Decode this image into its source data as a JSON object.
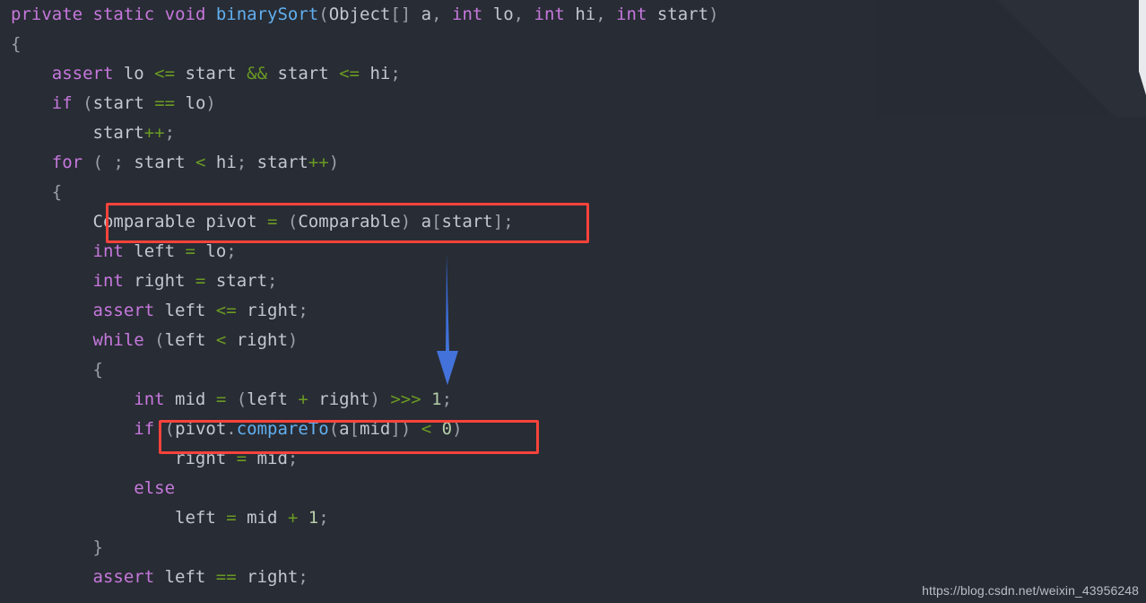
{
  "editor": {
    "background_color": "#282c34",
    "language": "java",
    "code_lines": [
      {
        "indent": 0,
        "tokens": [
          {
            "t": "private",
            "c": "kw"
          },
          {
            "t": " ",
            "c": "id"
          },
          {
            "t": "static",
            "c": "kw"
          },
          {
            "t": " ",
            "c": "id"
          },
          {
            "t": "void",
            "c": "kw"
          },
          {
            "t": " ",
            "c": "id"
          },
          {
            "t": "binarySort",
            "c": "fn"
          },
          {
            "t": "(",
            "c": "pn"
          },
          {
            "t": "Object",
            "c": "id"
          },
          {
            "t": "[] ",
            "c": "pn"
          },
          {
            "t": "a",
            "c": "id"
          },
          {
            "t": ", ",
            "c": "pn"
          },
          {
            "t": "int",
            "c": "kw"
          },
          {
            "t": " lo",
            "c": "id"
          },
          {
            "t": ", ",
            "c": "pn"
          },
          {
            "t": "int",
            "c": "kw"
          },
          {
            "t": " hi",
            "c": "id"
          },
          {
            "t": ", ",
            "c": "pn"
          },
          {
            "t": "int",
            "c": "kw"
          },
          {
            "t": " start",
            "c": "id"
          },
          {
            "t": ")",
            "c": "pn"
          }
        ]
      },
      {
        "indent": 0,
        "tokens": [
          {
            "t": "{",
            "c": "pn"
          }
        ]
      },
      {
        "indent": 4,
        "tokens": [
          {
            "t": "assert",
            "c": "kw"
          },
          {
            "t": " lo ",
            "c": "id"
          },
          {
            "t": "<=",
            "c": "op"
          },
          {
            "t": " start ",
            "c": "id"
          },
          {
            "t": "&&",
            "c": "op"
          },
          {
            "t": " start ",
            "c": "id"
          },
          {
            "t": "<=",
            "c": "op"
          },
          {
            "t": " hi",
            "c": "id"
          },
          {
            "t": ";",
            "c": "pn"
          }
        ]
      },
      {
        "indent": 4,
        "tokens": [
          {
            "t": "if",
            "c": "kw"
          },
          {
            "t": " ",
            "c": "id"
          },
          {
            "t": "(",
            "c": "pn"
          },
          {
            "t": "start ",
            "c": "id"
          },
          {
            "t": "==",
            "c": "op"
          },
          {
            "t": " lo",
            "c": "id"
          },
          {
            "t": ")",
            "c": "pn"
          }
        ]
      },
      {
        "indent": 8,
        "tokens": [
          {
            "t": "start",
            "c": "id"
          },
          {
            "t": "++",
            "c": "op"
          },
          {
            "t": ";",
            "c": "pn"
          }
        ]
      },
      {
        "indent": 4,
        "tokens": [
          {
            "t": "for",
            "c": "kw"
          },
          {
            "t": " ",
            "c": "id"
          },
          {
            "t": "(",
            "c": "pn"
          },
          {
            "t": " ",
            "c": "id"
          },
          {
            "t": ";",
            "c": "pn"
          },
          {
            "t": " start ",
            "c": "id"
          },
          {
            "t": "<",
            "c": "op"
          },
          {
            "t": " hi",
            "c": "id"
          },
          {
            "t": ";",
            "c": "pn"
          },
          {
            "t": " start",
            "c": "id"
          },
          {
            "t": "++",
            "c": "op"
          },
          {
            "t": ")",
            "c": "pn"
          }
        ]
      },
      {
        "indent": 4,
        "tokens": [
          {
            "t": "{",
            "c": "pn"
          }
        ]
      },
      {
        "indent": 8,
        "tokens": [
          {
            "t": "Comparable",
            "c": "id"
          },
          {
            "t": " pivot ",
            "c": "id"
          },
          {
            "t": "=",
            "c": "op"
          },
          {
            "t": " ",
            "c": "id"
          },
          {
            "t": "(",
            "c": "pn"
          },
          {
            "t": "Comparable",
            "c": "id"
          },
          {
            "t": ") ",
            "c": "pn"
          },
          {
            "t": "a",
            "c": "id"
          },
          {
            "t": "[",
            "c": "pn"
          },
          {
            "t": "start",
            "c": "id"
          },
          {
            "t": "]",
            "c": "pn"
          },
          {
            "t": ";",
            "c": "pn"
          }
        ]
      },
      {
        "indent": 8,
        "tokens": [
          {
            "t": "int",
            "c": "kw"
          },
          {
            "t": " left ",
            "c": "id"
          },
          {
            "t": "=",
            "c": "op"
          },
          {
            "t": " lo",
            "c": "id"
          },
          {
            "t": ";",
            "c": "pn"
          }
        ]
      },
      {
        "indent": 8,
        "tokens": [
          {
            "t": "int",
            "c": "kw"
          },
          {
            "t": " right ",
            "c": "id"
          },
          {
            "t": "=",
            "c": "op"
          },
          {
            "t": " start",
            "c": "id"
          },
          {
            "t": ";",
            "c": "pn"
          }
        ]
      },
      {
        "indent": 8,
        "tokens": [
          {
            "t": "assert",
            "c": "kw"
          },
          {
            "t": " left ",
            "c": "id"
          },
          {
            "t": "<=",
            "c": "op"
          },
          {
            "t": " right",
            "c": "id"
          },
          {
            "t": ";",
            "c": "pn"
          }
        ]
      },
      {
        "indent": 8,
        "tokens": [
          {
            "t": "while",
            "c": "kw"
          },
          {
            "t": " ",
            "c": "id"
          },
          {
            "t": "(",
            "c": "pn"
          },
          {
            "t": "left ",
            "c": "id"
          },
          {
            "t": "<",
            "c": "op"
          },
          {
            "t": " right",
            "c": "id"
          },
          {
            "t": ")",
            "c": "pn"
          }
        ]
      },
      {
        "indent": 8,
        "tokens": [
          {
            "t": "{",
            "c": "pn"
          }
        ]
      },
      {
        "indent": 12,
        "tokens": [
          {
            "t": "int",
            "c": "kw"
          },
          {
            "t": " mid ",
            "c": "id"
          },
          {
            "t": "=",
            "c": "op"
          },
          {
            "t": " ",
            "c": "id"
          },
          {
            "t": "(",
            "c": "pn"
          },
          {
            "t": "left ",
            "c": "id"
          },
          {
            "t": "+",
            "c": "op"
          },
          {
            "t": " right",
            "c": "id"
          },
          {
            "t": ") ",
            "c": "pn"
          },
          {
            "t": ">>>",
            "c": "op"
          },
          {
            "t": " ",
            "c": "id"
          },
          {
            "t": "1",
            "c": "num"
          },
          {
            "t": ";",
            "c": "pn"
          }
        ]
      },
      {
        "indent": 12,
        "tokens": [
          {
            "t": "if",
            "c": "kw"
          },
          {
            "t": " ",
            "c": "id"
          },
          {
            "t": "(",
            "c": "pn"
          },
          {
            "t": "pivot",
            "c": "id"
          },
          {
            "t": ".",
            "c": "pn"
          },
          {
            "t": "compareTo",
            "c": "fn"
          },
          {
            "t": "(",
            "c": "pn"
          },
          {
            "t": "a",
            "c": "id"
          },
          {
            "t": "[",
            "c": "pn"
          },
          {
            "t": "mid",
            "c": "id"
          },
          {
            "t": "]",
            "c": "pn"
          },
          {
            "t": ") ",
            "c": "pn"
          },
          {
            "t": "<",
            "c": "op"
          },
          {
            "t": " ",
            "c": "id"
          },
          {
            "t": "0",
            "c": "num"
          },
          {
            "t": ")",
            "c": "pn"
          }
        ]
      },
      {
        "indent": 16,
        "tokens": [
          {
            "t": "right ",
            "c": "id"
          },
          {
            "t": "=",
            "c": "op"
          },
          {
            "t": " mid",
            "c": "id"
          },
          {
            "t": ";",
            "c": "pn"
          }
        ]
      },
      {
        "indent": 12,
        "tokens": [
          {
            "t": "else",
            "c": "kw"
          }
        ]
      },
      {
        "indent": 16,
        "tokens": [
          {
            "t": "left ",
            "c": "id"
          },
          {
            "t": "=",
            "c": "op"
          },
          {
            "t": " mid ",
            "c": "id"
          },
          {
            "t": "+",
            "c": "op"
          },
          {
            "t": " ",
            "c": "id"
          },
          {
            "t": "1",
            "c": "num"
          },
          {
            "t": ";",
            "c": "pn"
          }
        ]
      },
      {
        "indent": 8,
        "tokens": [
          {
            "t": "}",
            "c": "pn"
          }
        ]
      },
      {
        "indent": 8,
        "tokens": [
          {
            "t": "assert",
            "c": "kw"
          },
          {
            "t": " left ",
            "c": "id"
          },
          {
            "t": "==",
            "c": "op"
          },
          {
            "t": " right",
            "c": "id"
          },
          {
            "t": ";",
            "c": "pn"
          }
        ]
      }
    ]
  },
  "annotations": {
    "color": "#f8433c",
    "arrow_color": "#3d6fd6",
    "highlight_boxes": [
      {
        "label": "pivot-assignment-highlight",
        "text": "Comparable pivot = (Comparable) a[start];"
      },
      {
        "label": "compare-condition-highlight",
        "text": "if (pivot.compareTo(a[mid]) < 0)"
      }
    ],
    "arrow": {
      "label": "down-arrow",
      "direction": "down",
      "from_line": "Comparable pivot = (Comparable) a[start];",
      "to_line": "if (pivot.compareTo(a[mid]) < 0)"
    }
  },
  "watermark": {
    "text": "https://blog.csdn.net/weixin_43956248"
  }
}
